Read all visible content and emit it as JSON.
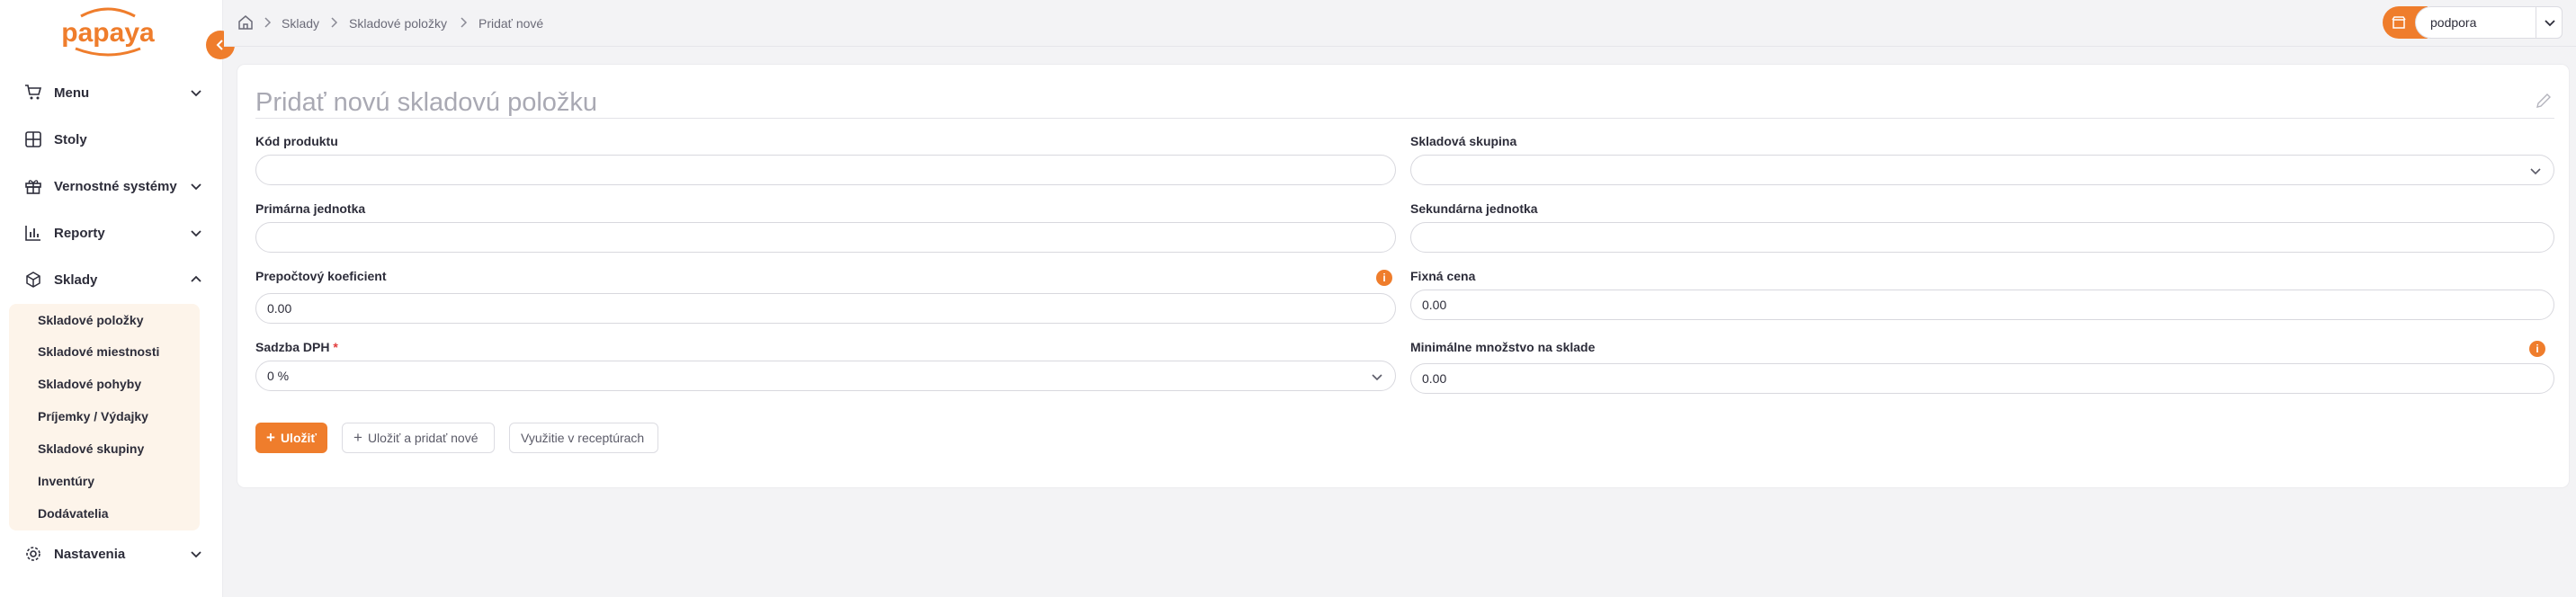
{
  "brand": {
    "name": "papaya",
    "accent": "#ef7d2c"
  },
  "sidebar": {
    "items": [
      {
        "label": "Menu",
        "icon": "cart-icon",
        "expandable": true
      },
      {
        "label": "Stoly",
        "icon": "table-grid-icon",
        "expandable": false
      },
      {
        "label": "Vernostné systémy",
        "icon": "gift-icon",
        "expandable": true
      },
      {
        "label": "Reporty",
        "icon": "bar-chart-icon",
        "expandable": true
      },
      {
        "label": "Sklady",
        "icon": "box-icon",
        "expandable": true,
        "expanded": true
      },
      {
        "label": "Nastavenia",
        "icon": "gear-icon",
        "expandable": true
      }
    ],
    "sub_items": [
      "Skladové položky",
      "Skladové miestnosti",
      "Skladové pohyby",
      "Príjemky / Výdajky",
      "Skladové skupiny",
      "Inventúry",
      "Dodávatelia"
    ]
  },
  "breadcrumb": [
    "Sklady",
    "Skladové položky",
    "Pridať nové"
  ],
  "store": {
    "value": "podpora"
  },
  "form": {
    "title": "Pridať novú skladovú položku",
    "fields": {
      "product_code": {
        "label": "Kód produktu",
        "value": ""
      },
      "stock_group": {
        "label": "Skladová skupina",
        "value": ""
      },
      "primary_unit": {
        "label": "Primárna jednotka",
        "value": ""
      },
      "secondary_unit": {
        "label": "Sekundárna jednotka",
        "value": ""
      },
      "conversion": {
        "label": "Prepočtový koeficient",
        "value": "0.00"
      },
      "fixed_price": {
        "label": "Fixná cena",
        "value": "0.00"
      },
      "vat": {
        "label": "Sadzba DPH",
        "required_mark": "*",
        "value": "0 %"
      },
      "min_qty": {
        "label": "Minimálne množstvo na sklade",
        "value": "0.00"
      }
    },
    "buttons": {
      "save": "Uložiť",
      "save_new": "Uložiť a pridať nové",
      "recipes": "Využitie v receptúrach"
    }
  }
}
